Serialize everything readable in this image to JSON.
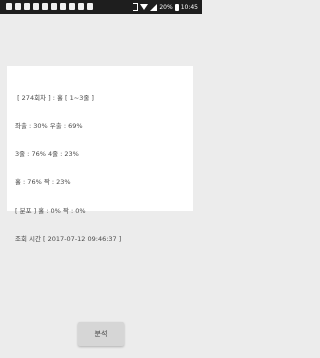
{
  "status_bar": {
    "battery_percent": "20%",
    "time": "10:45",
    "notification_icons": [
      "notification-icon",
      "notification-icon",
      "notification-icon",
      "notification-icon",
      "notification-icon",
      "notification-icon",
      "notification-icon",
      "notification-icon",
      "notification-icon",
      "notification-icon"
    ],
    "system_icons": [
      "bluetooth-icon",
      "wifi-icon",
      "signal-icon",
      "battery-icon"
    ]
  },
  "result": {
    "lines": [
      " [ 274회차 ] : 홀 [ 1~3줄 ]",
      "좌출 : 30% 우출 : 69%",
      "3줄 : 76% 4줄 : 23%",
      "홀 : 76% 짝 : 23%",
      "[ 분포 ] 홀 : 0% 짝 : 0%",
      "조회 시간 [ 2017-07-12 09:46:37 ]"
    ]
  },
  "analyze_button": {
    "label": "분석"
  },
  "colors": {
    "status_bar": "#1e1e1e",
    "background": "#ececec",
    "card": "#ffffff",
    "button": "#d6d6d6"
  }
}
